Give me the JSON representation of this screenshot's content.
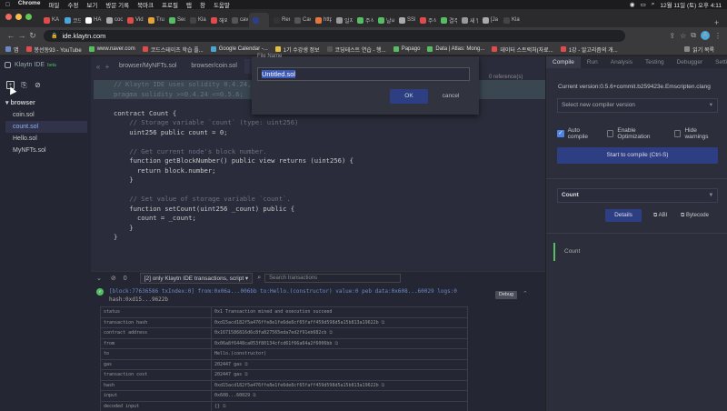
{
  "menubar": {
    "items": [
      "Chrome",
      "파일",
      "수정",
      "보기",
      "방문 기록",
      "북마크",
      "프로필",
      "탭",
      "창",
      "도움말"
    ],
    "datetime": "12월 11일 (토) 오후 4:11"
  },
  "tabs": [
    {
      "label": "KA",
      "color": "#e14b4b"
    },
    {
      "label": "코드",
      "color": "#4aa6d6"
    },
    {
      "label": "HA",
      "color": "#ffffff"
    },
    {
      "label": "coc",
      "color": "#aaaaaa"
    },
    {
      "label": "Vid",
      "color": "#e14b4b"
    },
    {
      "label": "Tru",
      "color": "#e4a23c"
    },
    {
      "label": "Sec",
      "color": "#56bd63"
    },
    {
      "label": "Kla",
      "color": "#444444"
    },
    {
      "label": "해외",
      "color": "#e14b4b"
    },
    {
      "label": "cav",
      "color": "#555555"
    },
    {
      "label": "",
      "color": "#2d3e82",
      "active": true
    },
    {
      "label": "Ren",
      "color": "#333333"
    },
    {
      "label": "Cav",
      "color": "#555555"
    },
    {
      "label": "http",
      "color": "#e4783c"
    },
    {
      "label": "일지",
      "color": "#999999"
    },
    {
      "label": "주식",
      "color": "#56bd63"
    },
    {
      "label": "날씨",
      "color": "#56bd63"
    },
    {
      "label": "SSI",
      "color": "#aaaaaa"
    },
    {
      "label": "주식",
      "color": "#e14b4b"
    },
    {
      "label": "결주",
      "color": "#56bd63"
    },
    {
      "label": "새 탭",
      "color": "#999999"
    },
    {
      "label": "[Ja",
      "color": "#aaaaaa"
    },
    {
      "label": "Klay",
      "color": "#444444"
    }
  ],
  "address": {
    "url": "ide.klaytn.com",
    "profile_initial": "A"
  },
  "bookmarks": {
    "items": [
      {
        "label": "앱",
        "color": "#6b8ac5"
      },
      {
        "label": "봉선동93 - YouTube",
        "color": "#e14b4b"
      },
      {
        "label": "www.naver.com",
        "color": "#56bd63"
      },
      {
        "label": "코드스테이츠 학습 플...",
        "color": "#e14b4b"
      },
      {
        "label": "Google Calendar -...",
        "color": "#4aa6d6"
      },
      {
        "label": "1기 수강생 정보",
        "color": "#e4c13c"
      },
      {
        "label": "코딩테스트 연습 - 행...",
        "color": "#555555"
      },
      {
        "label": "Papago",
        "color": "#56bd63"
      },
      {
        "label": "Data | Atlas: Mong...",
        "color": "#56bd63"
      },
      {
        "label": "데이터 스트럭처(자료...",
        "color": "#e14b4b"
      },
      {
        "label": "1강 - 알고리즘의 개...",
        "color": "#e14b4b"
      }
    ],
    "right_label": "읽기 목록"
  },
  "ide": {
    "brand": "Klaytn IDE",
    "brand_tag": "beta",
    "folder": "browser",
    "files": [
      "coin.sol",
      "count.sol",
      "Hello.sol",
      "MyNFTs.sol"
    ],
    "active_file": "count.sol",
    "editor_tabs": [
      "browser/MyNFTs.sol",
      "browser/coin.sol",
      "browser/count.sol"
    ],
    "ref_count": "0 reference(s)",
    "code": [
      {
        "text": "// Klaytn IDE uses solidity 0.4.24, 0.5.6 versions.",
        "cls": "c-comment",
        "hl": true
      },
      {
        "text": "pragma solidity >=0.4.24 <=0.5.6;",
        "cls": "c-comment",
        "hl": true
      },
      {
        "text": "",
        "cls": "",
        "hl": false
      },
      {
        "text": "contract Count {",
        "cls": "",
        "hl": false
      },
      {
        "text": "    // Storage variable `count` (type: uint256)",
        "cls": "c-comment",
        "hl": false
      },
      {
        "text": "    uint256 public count = 0;",
        "cls": "",
        "hl": false
      },
      {
        "text": "",
        "cls": "",
        "hl": false
      },
      {
        "text": "    // Get current node's block number.",
        "cls": "c-comment",
        "hl": false
      },
      {
        "text": "    function getBlockNumber() public view returns (uint256) {",
        "cls": "",
        "hl": false
      },
      {
        "text": "      return block.number;",
        "cls": "",
        "hl": false
      },
      {
        "text": "    }",
        "cls": "",
        "hl": false
      },
      {
        "text": "",
        "cls": "",
        "hl": false
      },
      {
        "text": "    // Set value of storage variable `count`.",
        "cls": "c-comment",
        "hl": false
      },
      {
        "text": "    function setCount(uint256 _count) public {",
        "cls": "",
        "hl": false
      },
      {
        "text": "      count = _count;",
        "cls": "",
        "hl": false
      },
      {
        "text": "    }",
        "cls": "",
        "hl": false
      },
      {
        "text": "}",
        "cls": "",
        "hl": false
      }
    ]
  },
  "modal": {
    "label": "File Name",
    "value": "Untitled.sol",
    "ok": "OK",
    "cancel": "cancel"
  },
  "terminal": {
    "counter": "0",
    "filter": "[2] only Klaytn IDE transactions, script",
    "search_placeholder": "Search transactions",
    "tx_line1": "[block:77636586 txIndex:0]  from:0x06a...006bb to:Hello.(constructor) value:0 peb data:0x608...60029 logs:0",
    "tx_line2": "hash:0xd15...9622b",
    "debug": "Debug",
    "rows": [
      [
        "status",
        "0x1 Transaction mined and execution succeed"
      ],
      [
        "transaction hash",
        "0xd15acd182f5a476ffe8e1fe6de8cf65faff459d598d5a15b813a19622b"
      ],
      [
        "contract address",
        "0x1671586816d6c8fa827565eda7ed2f91eb682cb"
      ],
      [
        "from",
        "0x06a8f6448ca053f80134cfcd61f66a64a2f6006bb"
      ],
      [
        "to",
        "Hello.(constructor)"
      ],
      [
        "gas",
        "202447 gas"
      ],
      [
        "transaction cost",
        "202447 gas"
      ],
      [
        "hash",
        "0xd15acd182f5a476ffe8e1fe6de8cf65faff459d598d5a15b813a19622b"
      ],
      [
        "input",
        "0x608...60029"
      ],
      [
        "decoded input",
        "{}"
      ]
    ]
  },
  "right": {
    "tabs": [
      "Compile",
      "Run",
      "Analysis",
      "Testing",
      "Debugger",
      "Settings"
    ],
    "version": "Current version:0.5.6+commit.b259423e.Emscripten.clang",
    "compiler_placeholder": "Select new compiler version",
    "auto_compile": "Auto compile",
    "enable_opt": "Enable Optimization",
    "hide_warnings": "Hide warnings",
    "compile_btn": "Start to compile (Ctrl-S)",
    "contract": "Count",
    "details": "Details",
    "abi": "ABI",
    "bytecode": "Bytecode",
    "deployed": "Count"
  }
}
